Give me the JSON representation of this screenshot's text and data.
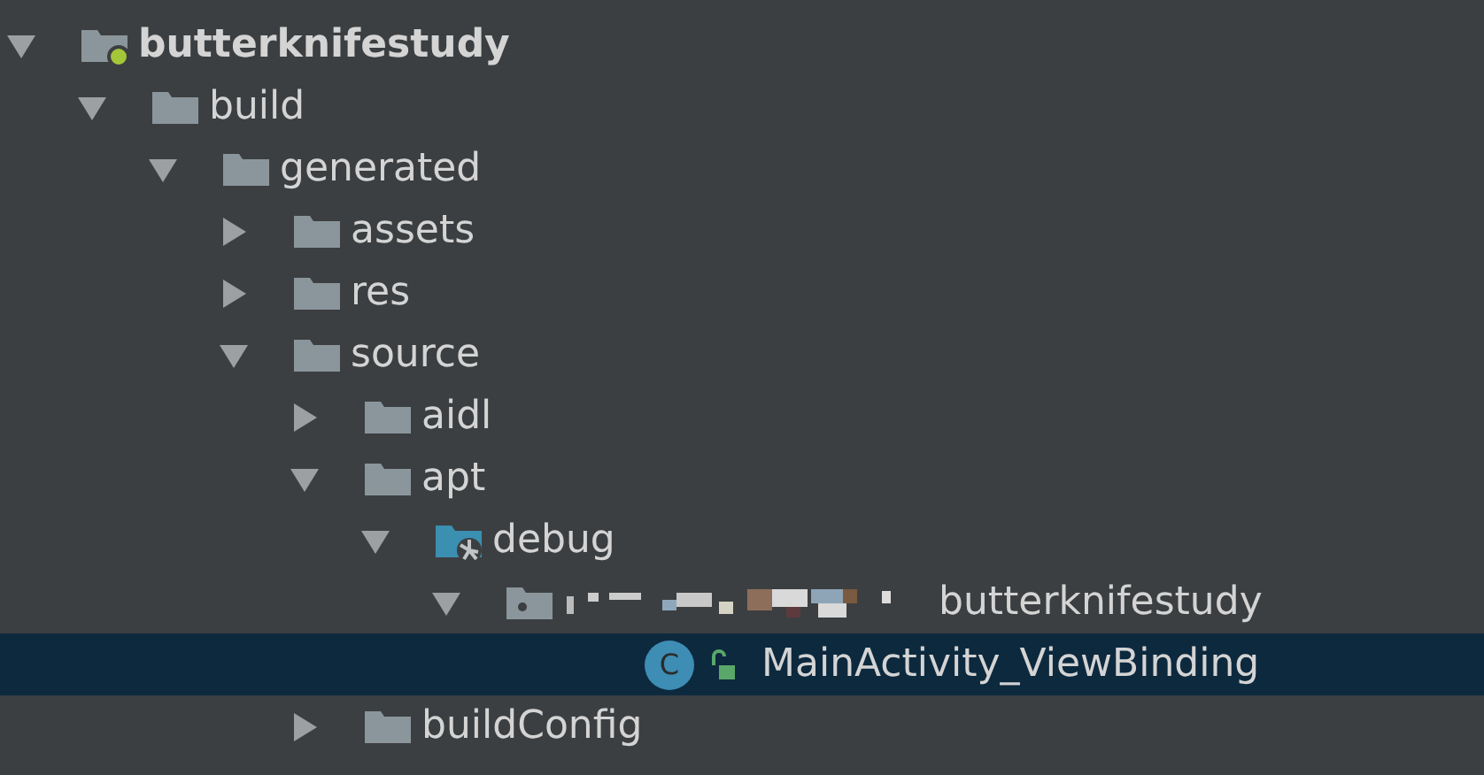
{
  "tree": [
    {
      "kind": "module",
      "label": "butterknifestudy",
      "expanded": true,
      "selected": false,
      "children": [
        {
          "kind": "folder",
          "label": "build",
          "expanded": true,
          "selected": false,
          "children": [
            {
              "kind": "folder",
              "label": "generated",
              "expanded": true,
              "selected": false,
              "children": [
                {
                  "kind": "folder",
                  "label": "assets",
                  "expanded": false,
                  "selected": false
                },
                {
                  "kind": "folder",
                  "label": "res",
                  "expanded": false,
                  "selected": false
                },
                {
                  "kind": "folder",
                  "label": "source",
                  "expanded": true,
                  "selected": false,
                  "children": [
                    {
                      "kind": "folder",
                      "label": "aidl",
                      "expanded": false,
                      "selected": false
                    },
                    {
                      "kind": "folder",
                      "label": "apt",
                      "expanded": true,
                      "selected": false,
                      "children": [
                        {
                          "kind": "source-root",
                          "label": "debug",
                          "expanded": true,
                          "selected": false,
                          "children": [
                            {
                              "kind": "package",
                              "label": "butterknifestudy",
                              "expanded": true,
                              "selected": false,
                              "children": [
                                {
                                  "kind": "class",
                                  "badge": "C",
                                  "label": "MainActivity_ViewBinding",
                                  "selected": true
                                }
                              ]
                            }
                          ]
                        }
                      ]
                    },
                    {
                      "kind": "folder",
                      "label": "buildConfig",
                      "expanded": false,
                      "selected": false
                    }
                  ]
                }
              ]
            }
          ]
        }
      ]
    }
  ]
}
